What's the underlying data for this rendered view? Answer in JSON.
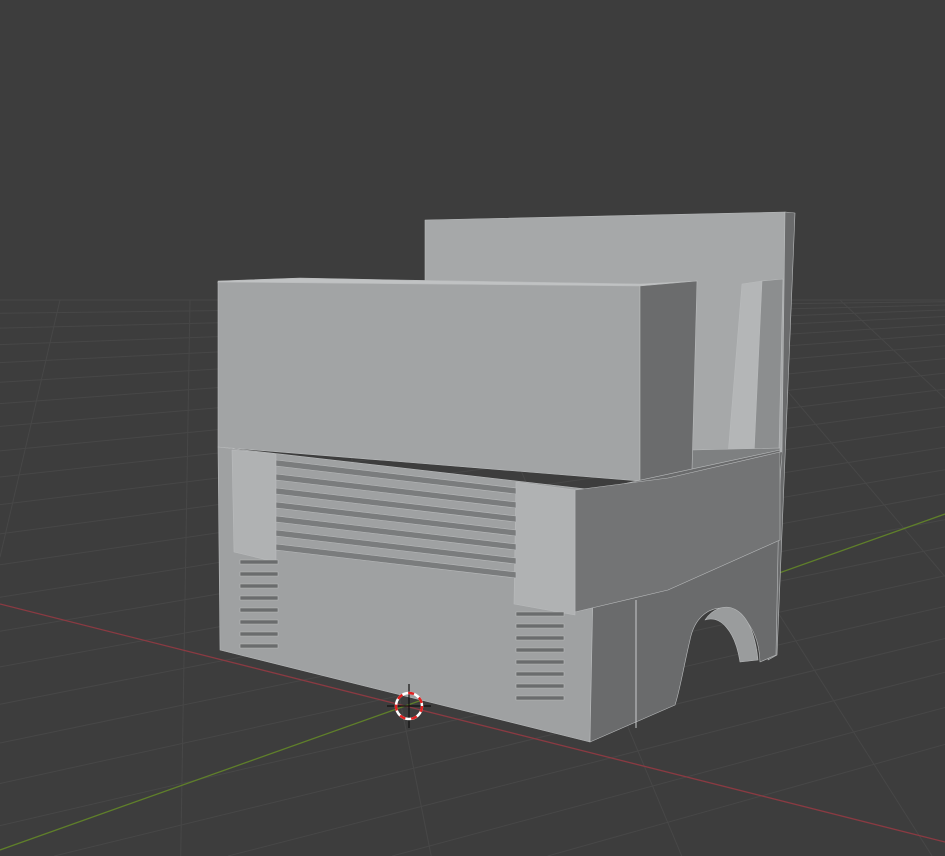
{
  "viewport": {
    "background": "#3d3d3d",
    "grid_color": "#4a4a4a",
    "x_axis_color": "#8a3a42",
    "y_axis_color": "#5f7f2a"
  },
  "model": {
    "face_light": "#a3a5a6",
    "face_mid": "#8e9091",
    "face_dark": "#646566",
    "edge_color": "#c4c6c7"
  },
  "cursor": {
    "icon": "3d-cursor-icon"
  }
}
